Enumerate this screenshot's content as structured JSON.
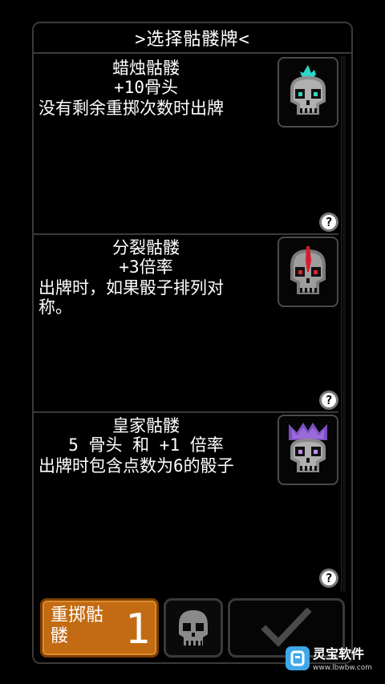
{
  "title": ">选择骷髅牌<",
  "cards": [
    {
      "name": "蜡烛骷髅",
      "effect": "+10骨头",
      "description": "没有剩余重掷次数时出牌",
      "icon": "candle-skull-icon",
      "accent": "#2fd6c8",
      "eye": "#2fd6c8"
    },
    {
      "name": "分裂骷髅",
      "effect": "+3倍率",
      "description": "出牌时，如果骰子排列对称。",
      "icon": "split-skull-icon",
      "accent": "#d61c2a",
      "eye": "#e02030"
    },
    {
      "name": "皇家骷髅",
      "effect": "5 骨头 和 +1 倍率",
      "description": "出牌时包含点数为6的骰子",
      "icon": "royal-skull-icon",
      "accent": "#9a6ad8",
      "eye": "#c58cf0"
    }
  ],
  "help_label": "?",
  "reroll": {
    "label": "重掷骷髅",
    "count": "1"
  },
  "watermark": {
    "name": "灵宝软件",
    "url": "www.lbwbw.com"
  },
  "colors": {
    "reroll_bg": "#c26b12",
    "border": "#3a3a3a"
  }
}
